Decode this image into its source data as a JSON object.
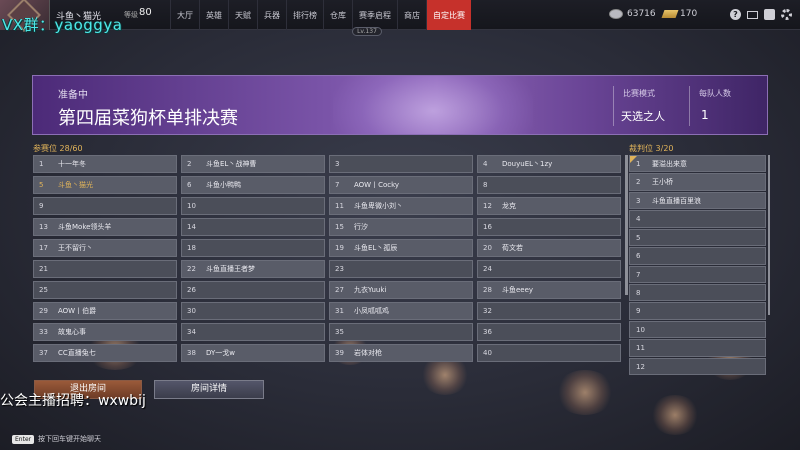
{
  "watermark_top": "VX群：yaoggya",
  "watermark_bottom": "公会主播招聘：wxwbij",
  "player": {
    "name": "斗鱼丶猫光",
    "level_label": "等级",
    "level": "80"
  },
  "nav": [
    {
      "label": "大厅",
      "active": false
    },
    {
      "label": "英雄",
      "active": false
    },
    {
      "label": "天赋",
      "active": false
    },
    {
      "label": "兵器",
      "active": false
    },
    {
      "label": "排行榜",
      "active": false
    },
    {
      "label": "仓库",
      "active": false
    },
    {
      "label": "赛季启程",
      "active": false
    },
    {
      "label": "商店",
      "active": false
    },
    {
      "label": "自定比赛",
      "active": true
    }
  ],
  "season_level": "Lv.137",
  "currency": {
    "silver": "63716",
    "gold": "170"
  },
  "top_icons": [
    "help-icon",
    "mail-icon",
    "chat-icon",
    "gear-icon"
  ],
  "banner": {
    "status": "准备中",
    "title": "第四届菜狗杯单排决赛",
    "mode_label": "比赛模式",
    "mode_value": "天选之人",
    "team_label": "每队人数",
    "team_value": "1"
  },
  "participants": {
    "label": "参赛位",
    "count": "28/60",
    "slots": [
      {
        "num": "1",
        "name": "十一年冬"
      },
      {
        "num": "2",
        "name": "斗鱼EL丶战神曹"
      },
      {
        "num": "3",
        "name": ""
      },
      {
        "num": "4",
        "name": "DouyuEL丶1zy"
      },
      {
        "num": "5",
        "name": "斗鱼丶猫光",
        "highlight": true
      },
      {
        "num": "6",
        "name": "斗鱼小鸭鸭"
      },
      {
        "num": "7",
        "name": "AOW丨Cocky"
      },
      {
        "num": "8",
        "name": ""
      },
      {
        "num": "9",
        "name": ""
      },
      {
        "num": "10",
        "name": ""
      },
      {
        "num": "11",
        "name": "斗鱼卑微小刘丶"
      },
      {
        "num": "12",
        "name": "龙克"
      },
      {
        "num": "13",
        "name": "斗鱼Moke领头羊"
      },
      {
        "num": "14",
        "name": ""
      },
      {
        "num": "15",
        "name": "行汐"
      },
      {
        "num": "16",
        "name": ""
      },
      {
        "num": "17",
        "name": "王不留行丶"
      },
      {
        "num": "18",
        "name": ""
      },
      {
        "num": "19",
        "name": "斗鱼EL丶孤辰"
      },
      {
        "num": "20",
        "name": "荀文若"
      },
      {
        "num": "21",
        "name": ""
      },
      {
        "num": "22",
        "name": "斗鱼直播王者梦"
      },
      {
        "num": "23",
        "name": ""
      },
      {
        "num": "24",
        "name": ""
      },
      {
        "num": "25",
        "name": ""
      },
      {
        "num": "26",
        "name": ""
      },
      {
        "num": "27",
        "name": "九衣Yuuki"
      },
      {
        "num": "28",
        "name": "斗鱼eeey"
      },
      {
        "num": "29",
        "name": "AOW丨伯爵"
      },
      {
        "num": "30",
        "name": ""
      },
      {
        "num": "31",
        "name": "小凤呱呱鸡"
      },
      {
        "num": "32",
        "name": ""
      },
      {
        "num": "33",
        "name": "故鬼心事"
      },
      {
        "num": "34",
        "name": ""
      },
      {
        "num": "35",
        "name": ""
      },
      {
        "num": "36",
        "name": ""
      },
      {
        "num": "37",
        "name": "CC直播兔七"
      },
      {
        "num": "38",
        "name": "DY一戈w"
      },
      {
        "num": "39",
        "name": "岩体对枪"
      },
      {
        "num": "40",
        "name": ""
      }
    ]
  },
  "referees": {
    "label": "裁判位",
    "count": "3/20",
    "slots": [
      {
        "num": "1",
        "name": "要溢出来意",
        "owner": true
      },
      {
        "num": "2",
        "name": "王小桥"
      },
      {
        "num": "3",
        "name": "斗鱼直播百里浪"
      },
      {
        "num": "4",
        "name": ""
      },
      {
        "num": "5",
        "name": ""
      },
      {
        "num": "6",
        "name": ""
      },
      {
        "num": "7",
        "name": ""
      },
      {
        "num": "8",
        "name": ""
      },
      {
        "num": "9",
        "name": ""
      },
      {
        "num": "10",
        "name": ""
      },
      {
        "num": "11",
        "name": ""
      },
      {
        "num": "12",
        "name": ""
      }
    ]
  },
  "buttons": {
    "leave": "退出房间",
    "details": "房间详情"
  },
  "chat_hint": {
    "key": "Enter",
    "text": "按下回车键开始聊天"
  }
}
